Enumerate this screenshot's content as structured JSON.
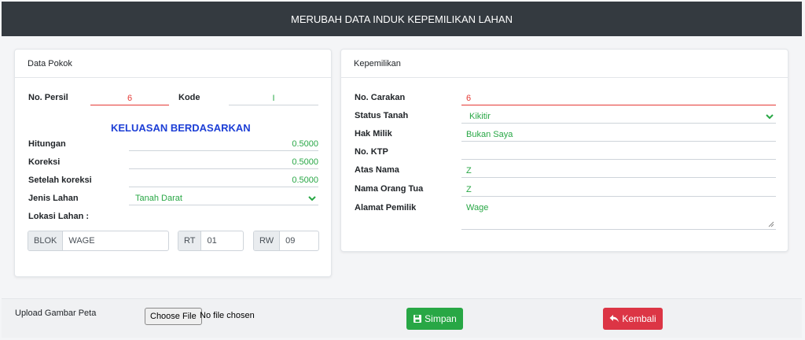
{
  "header": {
    "title": "MERUBAH DATA INDUK KEPEMILIKAN LAHAN"
  },
  "colors": {
    "header_bg": "#343a40",
    "accent_green": "#28a745",
    "accent_red": "#dc3545",
    "heading_blue": "#1d3fd6"
  },
  "data_pokok": {
    "title": "Data Pokok",
    "no_persil_label": "No. Persil",
    "no_persil_value": "6",
    "kode_label": "Kode",
    "kode_value": "I",
    "keluasan_heading": "KELUASAN BERDASARKAN",
    "hitungan_label": "Hitungan",
    "hitungan_value": "0.5000",
    "koreksi_label": "Koreksi",
    "koreksi_value": "0.5000",
    "setelah_label": "Setelah koreksi",
    "setelah_value": "0.5000",
    "jenis_label": "Jenis Lahan",
    "jenis_value": "Tanah Darat",
    "lokasi_label": "Lokasi Lahan :",
    "blok_addon": "BLOK",
    "blok_value": "WAGE",
    "rt_addon": "RT",
    "rt_value": "01",
    "rw_addon": "RW",
    "rw_value": "09"
  },
  "kepemilikan": {
    "title": "Kepemilikan",
    "carakan_label": "No. Carakan",
    "carakan_value": "6",
    "status_label": "Status Tanah",
    "status_value": "Kikitir",
    "hak_label": "Hak Milik",
    "hak_value": "Bukan Saya",
    "ktp_label": "No. KTP",
    "ktp_value": "",
    "atas_label": "Atas Nama",
    "atas_value": "Z",
    "ortu_label": "Nama Orang Tua",
    "ortu_value": "Z",
    "alamat_label": "Alamat Pemilik",
    "alamat_value": "Wage"
  },
  "footer": {
    "upload_label": "Upload Gambar Peta",
    "choose_file": "Choose File",
    "no_file": "No file chosen",
    "save_label": "Simpan",
    "save_icon": "floppy-disk-icon",
    "back_label": "Kembali",
    "back_icon": "reply-arrow-icon"
  }
}
